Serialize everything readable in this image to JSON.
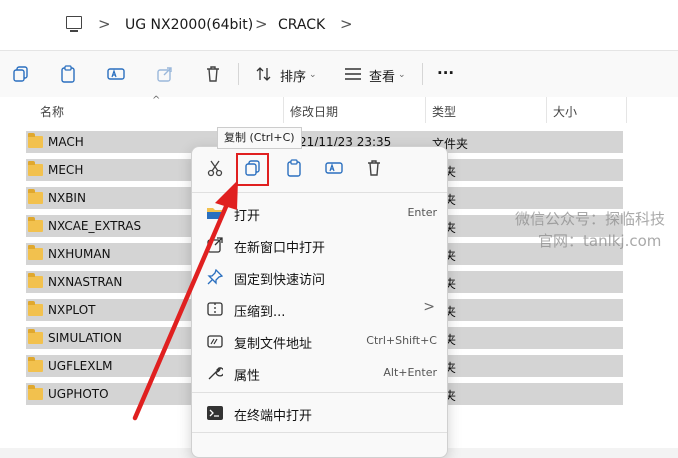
{
  "address": {
    "path": [
      "UG NX2000(64bit)",
      "CRACK"
    ],
    "separator": ">"
  },
  "toolbar": {
    "sort_label": "排序",
    "view_label": "查看",
    "more_label": "···"
  },
  "columns": {
    "name": "名称",
    "date": "修改日期",
    "type": "类型",
    "size": "大小"
  },
  "rows": [
    {
      "name": "MACH",
      "date": "21/11/23 23:35",
      "type": "文件夹"
    },
    {
      "name": "MECH",
      "date": "",
      "type": "件夹"
    },
    {
      "name": "NXBIN",
      "date": "",
      "type": "件夹"
    },
    {
      "name": "NXCAE_EXTRAS",
      "date": "",
      "type": "件夹"
    },
    {
      "name": "NXHUMAN",
      "date": "",
      "type": "件夹"
    },
    {
      "name": "NXNASTRAN",
      "date": "",
      "type": "件夹"
    },
    {
      "name": "NXPLOT",
      "date": "",
      "type": "件夹"
    },
    {
      "name": "SIMULATION",
      "date": "",
      "type": "件夹"
    },
    {
      "name": "UGFLEXLM",
      "date": "",
      "type": "件夹"
    },
    {
      "name": "UGPHOTO",
      "date": "",
      "type": "件夹"
    }
  ],
  "tooltip": "复制 (Ctrl+C)",
  "menu": {
    "items": [
      {
        "label": "打开",
        "shortcut": "Enter"
      },
      {
        "label": "在新窗口中打开",
        "shortcut": ""
      },
      {
        "label": "固定到快速访问",
        "shortcut": ""
      },
      {
        "label": "压缩到...",
        "shortcut": "",
        "arrow": ">"
      },
      {
        "label": "复制文件地址",
        "shortcut": "Ctrl+Shift+C"
      },
      {
        "label": "属性",
        "shortcut": "Alt+Enter"
      },
      {
        "label": "在终端中打开",
        "shortcut": ""
      }
    ]
  },
  "watermark": {
    "line1": "微信公众号：探临科技",
    "line2": "官网：tanlkj.com"
  },
  "colors": {
    "accent": "#2a6fbf",
    "highlight": "#e02020",
    "folder": "#f2c14e",
    "row_selected": "#d4d4d4"
  }
}
